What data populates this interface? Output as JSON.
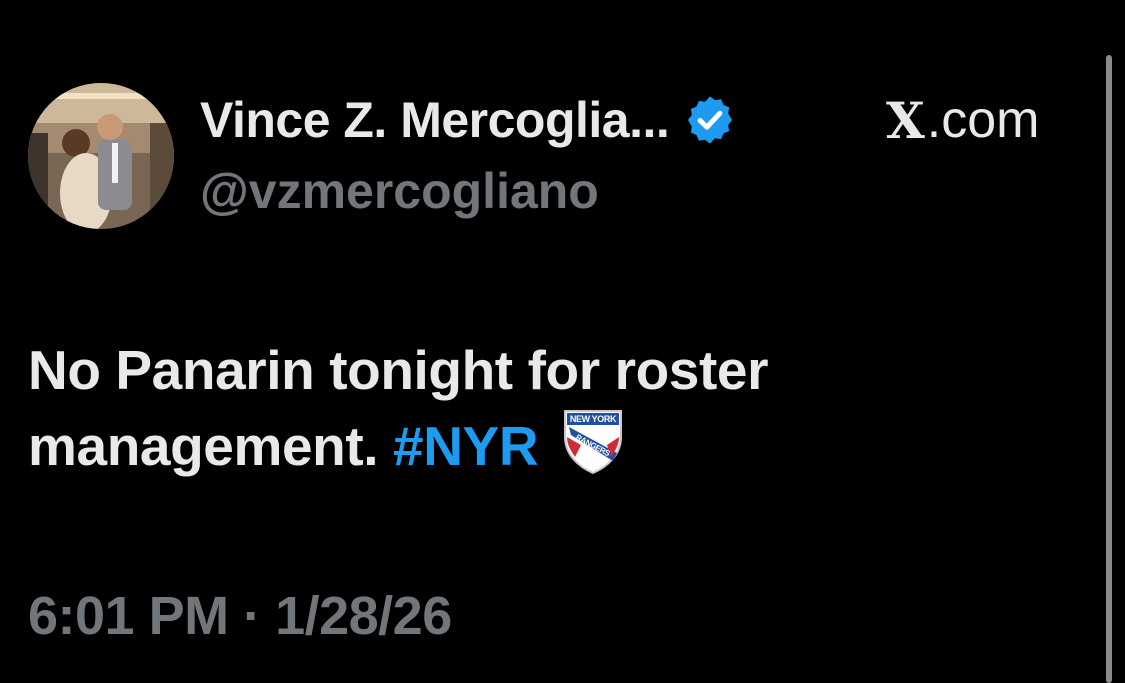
{
  "tweet": {
    "author": {
      "display_name": "Vince Z. Mercoglia...",
      "handle": "@vzmercogliano",
      "verified_icon": "verified-badge-icon",
      "verified_color": "#1d9bf0"
    },
    "source": {
      "logo": "X",
      "suffix": ".com"
    },
    "text": {
      "line1": "No Panarin tonight for roster",
      "line2": "management.",
      "hashtag": "#NYR",
      "emoji": "new-york-rangers-logo-icon",
      "emoji_text_top": "NEW YORK",
      "emoji_text_bottom": "RANGERS"
    },
    "timestamp": "6:01 PM · 1/28/26"
  },
  "colors": {
    "background": "#000000",
    "primary_text": "#e7e9ea",
    "secondary_text": "#71767b",
    "accent": "#1d9bf0"
  }
}
